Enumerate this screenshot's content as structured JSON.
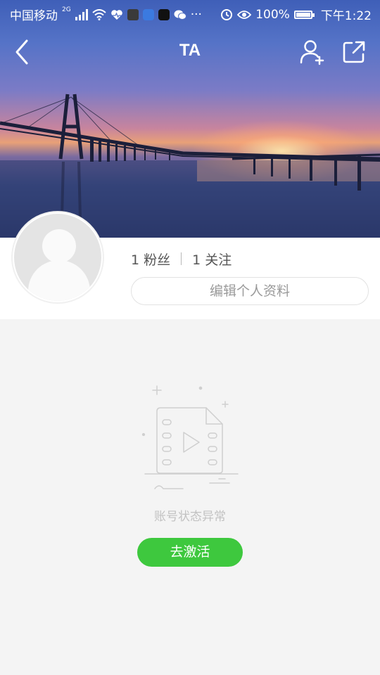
{
  "status_bar": {
    "carrier": "中国移动",
    "network": "2G",
    "battery": "100%",
    "time": "下午1:22",
    "more": "···",
    "icons": [
      "signal-icon",
      "wifi-icon",
      "health-icon",
      "app-icon",
      "tiktok-icon",
      "wechat-icon",
      "alarm-icon",
      "eye-icon",
      "battery-icon"
    ]
  },
  "nav": {
    "title": "TA"
  },
  "profile": {
    "followers_count": "1",
    "followers_label": "粉丝",
    "following_count": "1",
    "following_label": "关注",
    "edit_label": "编辑个人资料"
  },
  "empty_state": {
    "message": "账号状态异常",
    "action_label": "去激活"
  },
  "colors": {
    "accent": "#3ec83e",
    "page_bg": "#f4f4f4"
  }
}
